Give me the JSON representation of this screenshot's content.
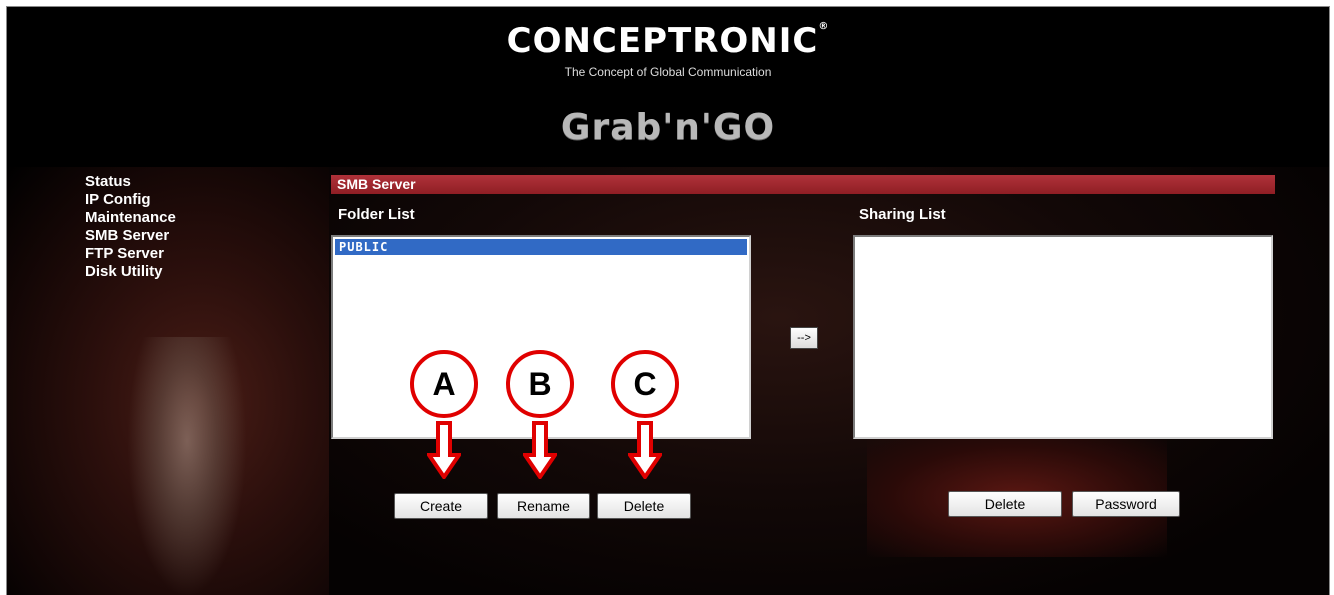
{
  "header": {
    "logo": "CONCEPTRONIC",
    "registered_mark": "®",
    "tagline": "The Concept of Global Communication",
    "product": "Grab'n'GO"
  },
  "nav": {
    "items": [
      "Status",
      "IP Config",
      "Maintenance",
      "SMB Server",
      "FTP Server",
      "Disk Utility"
    ]
  },
  "section": {
    "title": "SMB Server",
    "folder_list_label": "Folder List",
    "sharing_list_label": "Sharing List",
    "folder_items": [
      "PUBLIC"
    ],
    "sharing_items": [],
    "move_button": "-->",
    "folder_buttons": {
      "create": "Create",
      "rename": "Rename",
      "delete": "Delete"
    },
    "sharing_buttons": {
      "delete": "Delete",
      "password": "Password"
    }
  },
  "annotations": {
    "callouts": [
      "A",
      "B",
      "C"
    ],
    "color": "#e00000"
  },
  "colors": {
    "section_bar": "#a52a30",
    "list_selection": "#316ac5"
  }
}
